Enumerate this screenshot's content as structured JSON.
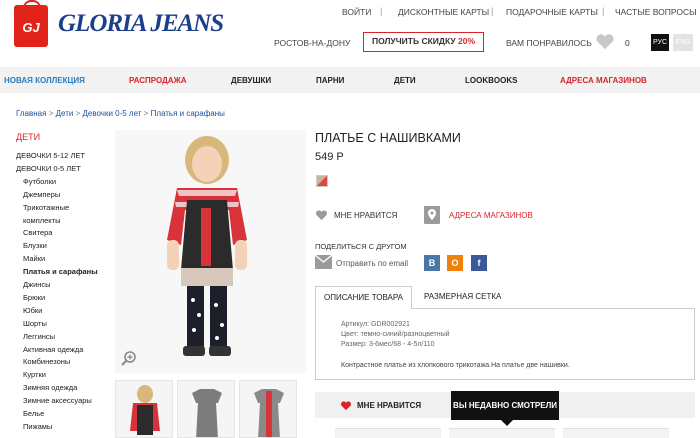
{
  "header": {
    "logo_mark": "GJ",
    "logo_text": "GLORIA JEANS",
    "top_links": [
      "ВОЙТИ",
      "ДИСКОНТНЫЕ КАРТЫ",
      "ПОДАРОЧНЫЕ КАРТЫ",
      "ЧАСТЫЕ ВОПРОСЫ"
    ],
    "separator": "|",
    "city": "РОСТОВ-НА-ДОНУ",
    "discount_label": "ПОЛУЧИТЬ СКИДКУ",
    "discount_value": "20%",
    "favorites_label": "ВАМ ПОНРАВИЛОСЬ",
    "favorites_count": "0",
    "lang_ru": "РУС",
    "lang_en": "ENG"
  },
  "nav": [
    "НОВАЯ КОЛЛЕКЦИЯ",
    "РАСПРОДАЖА",
    "ДЕВУШКИ",
    "ПАРНИ",
    "ДЕТИ",
    "LOOKBOOKS",
    "АДРЕСА МАГАЗИНОВ"
  ],
  "breadcrumb": [
    "Главная",
    ">",
    "Дети",
    ">",
    "Девочки 0-5 лет",
    ">",
    "Платья и сарафаны"
  ],
  "sidebar": {
    "title": "ДЕТИ",
    "items": [
      {
        "label": "ДЕВОЧКИ 5-12 ЛЕТ",
        "level": 0
      },
      {
        "label": "ДЕВОЧКИ 0-5 ЛЕТ",
        "level": 0
      },
      {
        "label": "Футболки",
        "level": 1
      },
      {
        "label": "Джемперы",
        "level": 1
      },
      {
        "label": "Трикотажные",
        "level": 1
      },
      {
        "label": "комплекты",
        "level": 1
      },
      {
        "label": "Свитера",
        "level": 1
      },
      {
        "label": "Блузки",
        "level": 1
      },
      {
        "label": "Майки",
        "level": 1
      },
      {
        "label": "Платья и сарафаны",
        "level": 1
      },
      {
        "label": "Джинсы",
        "level": 1
      },
      {
        "label": "Брюки",
        "level": 1
      },
      {
        "label": "Юбки",
        "level": 1
      },
      {
        "label": "Шорты",
        "level": 1
      },
      {
        "label": "Леггинсы",
        "level": 1
      },
      {
        "label": "Активная одежда",
        "level": 1
      },
      {
        "label": "Комбинезоны",
        "level": 1
      },
      {
        "label": "Куртки",
        "level": 1
      },
      {
        "label": "Зимняя одежда",
        "level": 1
      },
      {
        "label": "Зимние аксессуары",
        "level": 1
      },
      {
        "label": "Белье",
        "level": 1
      },
      {
        "label": "Пижамы",
        "level": 1
      }
    ]
  },
  "product": {
    "title": "ПЛАТЬЕ С НАШИВКАМИ",
    "price": "549 Р",
    "like_label": "МНЕ НРАВИТСЯ",
    "stores_label": "АДРЕСА МАГАЗИНОВ",
    "share_label": "ПОДЕЛИТЬСЯ С ДРУГОМ",
    "email_label": "Отправить по email",
    "social": [
      {
        "name": "vk",
        "glyph": "В",
        "color": "#4a76a8"
      },
      {
        "name": "ok",
        "glyph": "О",
        "color": "#ee8208"
      },
      {
        "name": "fb",
        "glyph": "f",
        "color": "#3b5998"
      }
    ],
    "tabs": [
      "ОПИСАНИЕ ТОВАРА",
      "РАЗМЕРНАЯ СЕТКА"
    ],
    "article": "Артикул: GDR002921",
    "color": "Цвет: темно-синий/разноцветный",
    "size": "Размер: 3-6мес/68 - 4-5л/110",
    "description": "Контрастное платье из хлопкового трикотажа.На платье две нашивки."
  },
  "bottom": {
    "like_tab": "МНЕ НРАВИТСЯ",
    "recent_tab": "ВЫ НЕДАВНО СМОТРЕЛИ"
  },
  "colors": {
    "accent_red": "#d9242b",
    "brand_blue": "#1b3f8b",
    "nav_bg": "#f2f2f2"
  }
}
